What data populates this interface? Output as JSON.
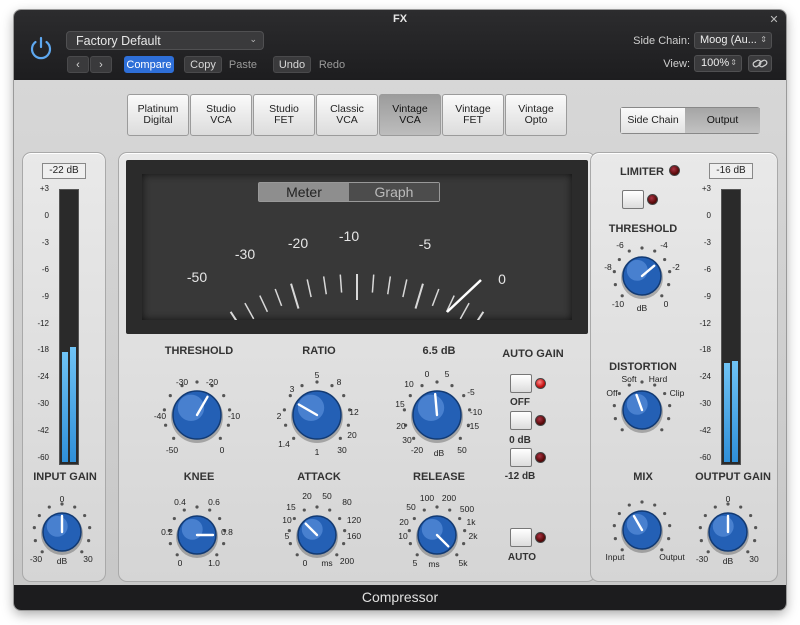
{
  "window": {
    "title": "FX"
  },
  "header": {
    "preset": "Factory Default",
    "compare_label": "Compare",
    "copy_label": "Copy",
    "paste_label": "Paste",
    "undo_label": "Undo",
    "redo_label": "Redo",
    "sidechain_label": "Side Chain:",
    "sidechain_value": "Moog (Au...",
    "view_label": "View:",
    "view_value": "100%"
  },
  "circuit_types": [
    {
      "label": "Platinum\nDigital",
      "selected": false
    },
    {
      "label": "Studio\nVCA",
      "selected": false
    },
    {
      "label": "Studio\nFET",
      "selected": false
    },
    {
      "label": "Classic\nVCA",
      "selected": false
    },
    {
      "label": "Vintage\nVCA",
      "selected": true
    },
    {
      "label": "Vintage\nFET",
      "selected": false
    },
    {
      "label": "Vintage\nOpto",
      "selected": false
    }
  ],
  "view_tabs": {
    "sidechain": "Side Chain",
    "output": "Output"
  },
  "meter_tabs": {
    "meter": "Meter",
    "graph": "Graph"
  },
  "vu_scale": [
    "-50",
    "-30",
    "-20",
    "-10",
    "-5",
    "0"
  ],
  "input": {
    "level": "-22 dB",
    "scale": [
      "+3",
      "0",
      "-3",
      "-6",
      "-9",
      "-12",
      "-18",
      "-24",
      "-30",
      "-42",
      "-60"
    ],
    "meter_fill": 0.42,
    "gain_label": "INPUT GAIN",
    "gain_ticks": [
      "0",
      "-30",
      "dB",
      "30"
    ]
  },
  "output": {
    "level": "-16 dB",
    "scale": [
      "+3",
      "0",
      "-3",
      "-6",
      "-9",
      "-12",
      "-18",
      "-24",
      "-30",
      "-42",
      "-60"
    ],
    "meter_fill": 0.55,
    "gain_label": "OUTPUT GAIN",
    "gain_ticks": [
      "0",
      "-30",
      "dB",
      "30"
    ]
  },
  "knobs": {
    "threshold": {
      "label": "THRESHOLD",
      "ticks": [
        "-30",
        "-20",
        "-40",
        "-10",
        "-50",
        "0"
      ]
    },
    "ratio": {
      "label": "RATIO",
      "ticks": [
        "5",
        "8",
        "3",
        "12",
        "2",
        "20",
        "1.4",
        "30",
        "1"
      ]
    },
    "makeup": {
      "label": "6.5 dB",
      "ticks": [
        "0",
        "5",
        "10",
        "-5",
        "15",
        "-10",
        "20",
        "-15",
        "30",
        "-20",
        "dB",
        "50"
      ]
    },
    "knee": {
      "label": "KNEE",
      "ticks": [
        "0.4",
        "0.6",
        "0.2",
        "0.8",
        "0",
        "1.0"
      ]
    },
    "attack": {
      "label": "ATTACK",
      "ticks": [
        "20",
        "50",
        "80",
        "15",
        "120",
        "10",
        "160",
        "5",
        "200",
        "0",
        "ms"
      ]
    },
    "release": {
      "label": "RELEASE",
      "ticks": [
        "100",
        "200",
        "50",
        "500",
        "20",
        "1k",
        "10",
        "2k",
        "5",
        "ms",
        "5k"
      ]
    }
  },
  "auto_gain": {
    "label": "AUTO GAIN",
    "options": [
      "OFF",
      "0 dB",
      "-12 dB"
    ],
    "auto_label": "AUTO"
  },
  "limiter": {
    "label": "LIMITER",
    "threshold_label": "THRESHOLD",
    "ticks": [
      "-6",
      "-4",
      "-8",
      "-2",
      "-10",
      "dB",
      "0"
    ]
  },
  "distortion": {
    "label": "DISTORTION",
    "ticks": [
      "Soft",
      "Hard",
      "Off",
      "Clip"
    ]
  },
  "mix": {
    "label": "MIX",
    "ticks": [
      "Input",
      "Output"
    ]
  },
  "footer": {
    "name": "Compressor"
  }
}
